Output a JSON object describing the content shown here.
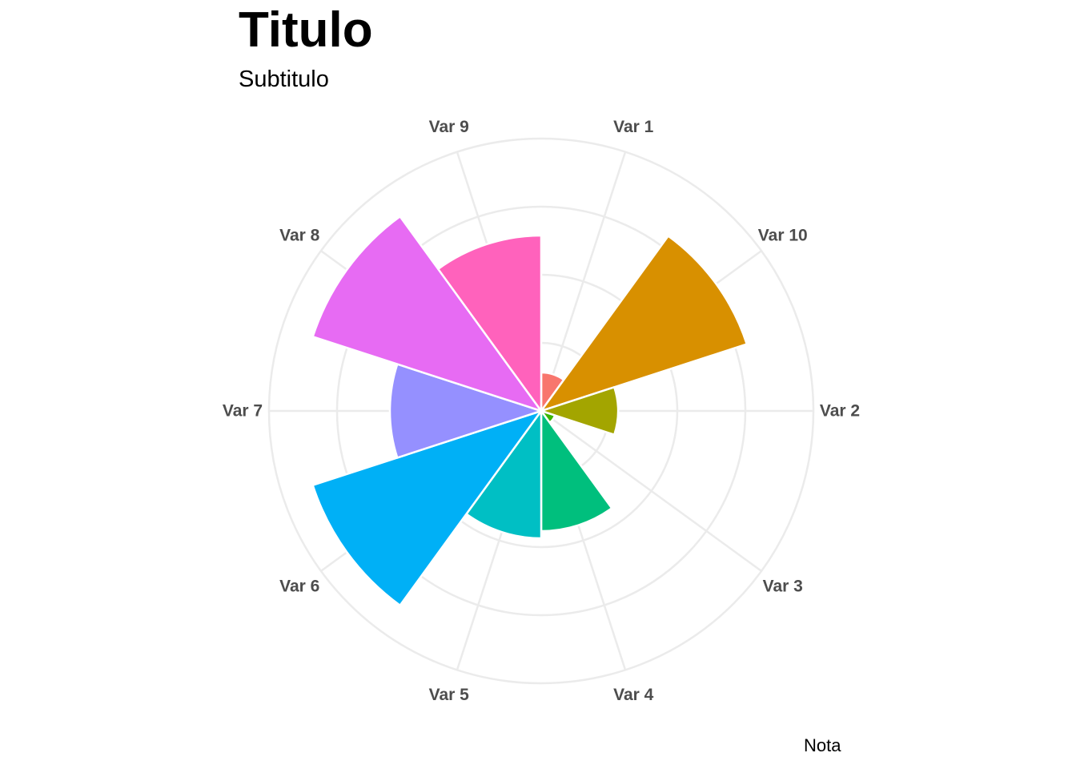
{
  "chart_data": {
    "type": "bar",
    "coord": "polar",
    "title": "Titulo",
    "subtitle": "Subtitulo",
    "caption": "Nota",
    "categories": [
      "Var 1",
      "Var 10",
      "Var 2",
      "Var 3",
      "Var 4",
      "Var 5",
      "Var 6",
      "Var 7",
      "Var 8",
      "Var 9"
    ],
    "values": [
      1.6,
      9.0,
      3.2,
      0.6,
      5.0,
      5.3,
      10.0,
      6.3,
      10.0,
      7.3
    ],
    "colors": [
      "#F8766D",
      "#D89000",
      "#A3A500",
      "#39B600",
      "#00BF7D",
      "#00BFC4",
      "#00B0F6",
      "#9590FF",
      "#E76BF3",
      "#FF62BC"
    ],
    "grid": true,
    "legend": "none"
  }
}
